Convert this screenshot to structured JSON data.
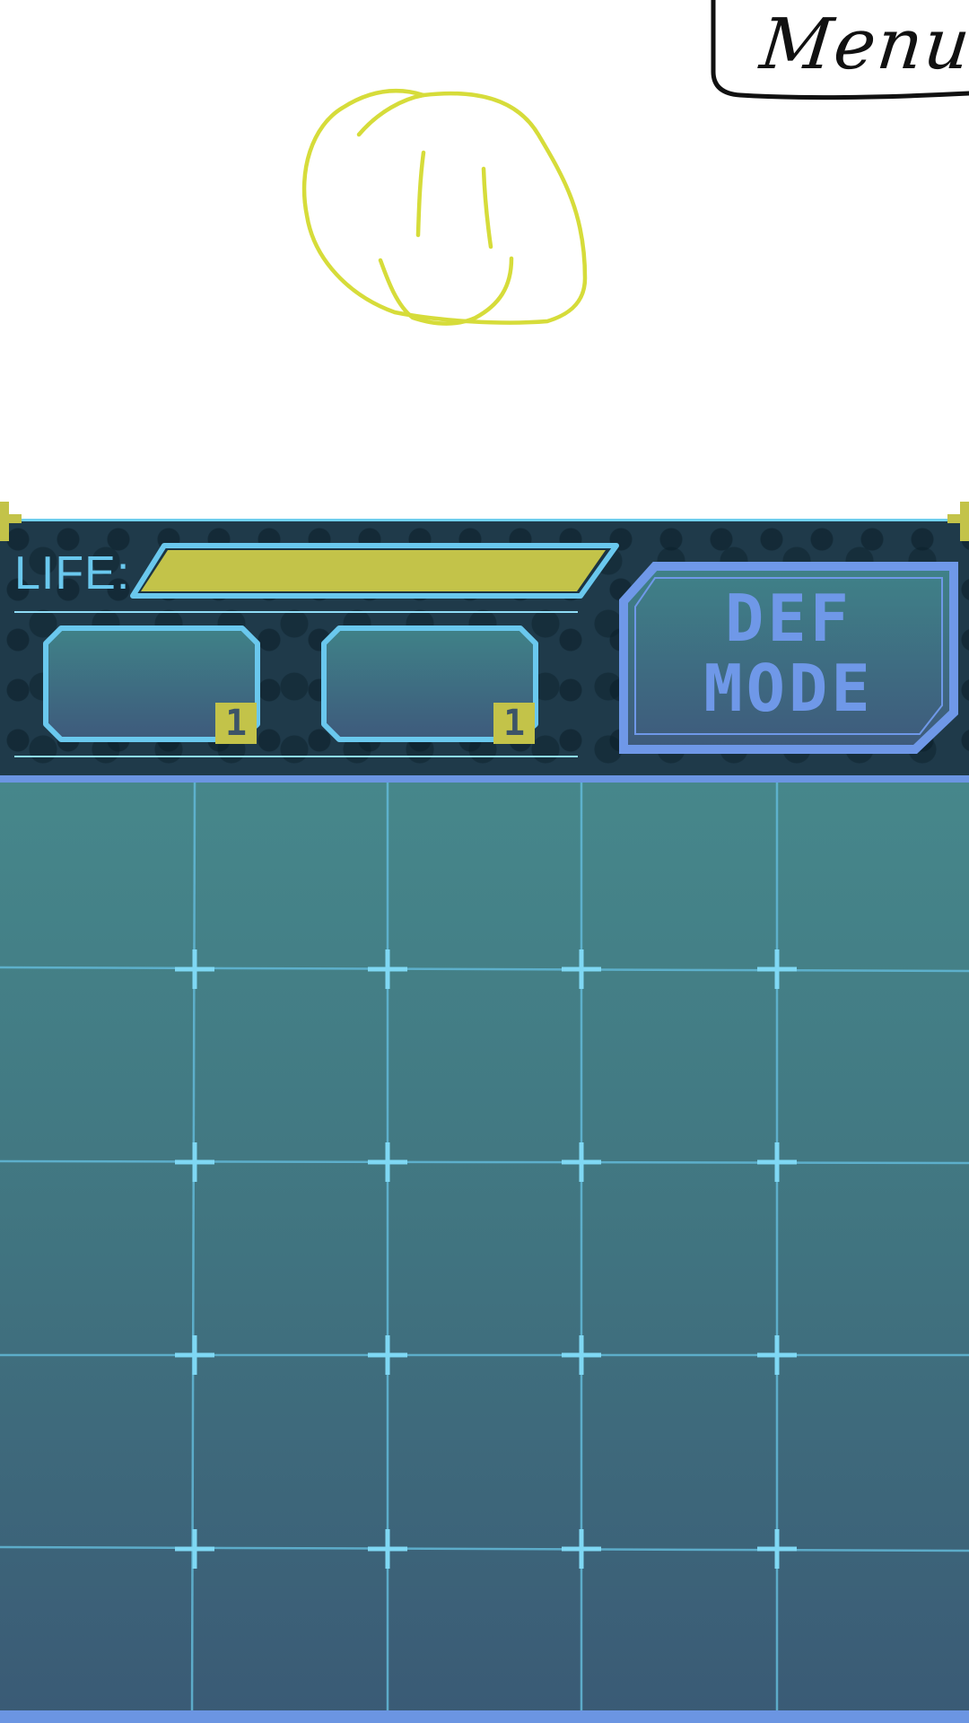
{
  "menu": {
    "label": "Menu"
  },
  "sketch": {
    "icon": "smiley-face-icon",
    "color": "#d6dc3a"
  },
  "hud": {
    "life_label": "LIFE:",
    "life_level": 1.0,
    "life_color": "#c3c349",
    "slots": [
      {
        "count": "1"
      },
      {
        "count": "1"
      }
    ],
    "mode_button": {
      "line1": "DEF",
      "line2": "MODE"
    }
  },
  "board": {
    "columns": 5,
    "rows": 5
  },
  "colors": {
    "accent_cyan": "#6ac8ee",
    "accent_blue": "#6f98e8",
    "hud_background": "#1f3a4a",
    "board_top": "#46878b",
    "board_bottom": "#3a5a75"
  }
}
